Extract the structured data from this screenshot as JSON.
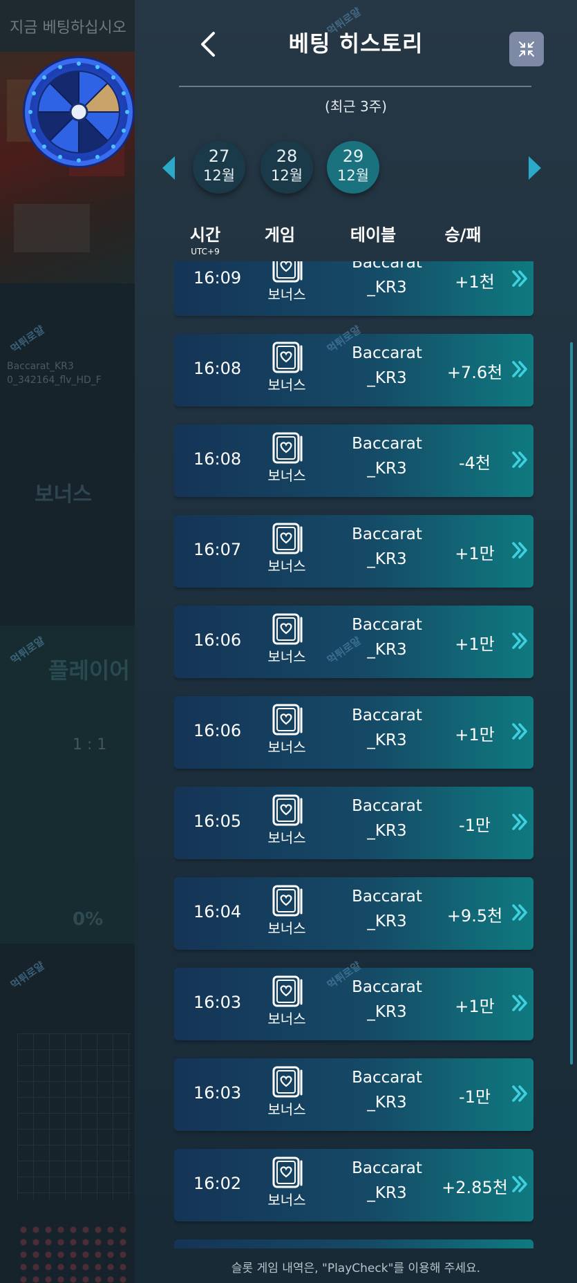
{
  "background": {
    "bet_hint": "지금 베팅하십시오",
    "table_id_line1": "Baccarat_KR3",
    "table_id_line2": "0_342164_flv_HD_F",
    "bonus_label": "보너스",
    "player_label": "플레이어",
    "ratio": "1 : 1",
    "percent": "0%"
  },
  "header": {
    "title": "베팅 히스토리",
    "subtitle": "(최근 3주)"
  },
  "dates": [
    {
      "day": "27",
      "month": "12월"
    },
    {
      "day": "28",
      "month": "12월"
    },
    {
      "day": "29",
      "month": "12월",
      "selected": true
    }
  ],
  "columns": {
    "time": "시간",
    "time_sub": "UTC+9",
    "game": "게임",
    "table": "테이블",
    "result": "승/패"
  },
  "rows": [
    {
      "time": "16:09",
      "game": "보너스",
      "table_line1": "Baccarat",
      "table_line2": "_KR3",
      "result": "+1천"
    },
    {
      "time": "16:08",
      "game": "보너스",
      "table_line1": "Baccarat",
      "table_line2": "_KR3",
      "result": "+7.6천"
    },
    {
      "time": "16:08",
      "game": "보너스",
      "table_line1": "Baccarat",
      "table_line2": "_KR3",
      "result": "-4천"
    },
    {
      "time": "16:07",
      "game": "보너스",
      "table_line1": "Baccarat",
      "table_line2": "_KR3",
      "result": "+1만"
    },
    {
      "time": "16:06",
      "game": "보너스",
      "table_line1": "Baccarat",
      "table_line2": "_KR3",
      "result": "+1만"
    },
    {
      "time": "16:06",
      "game": "보너스",
      "table_line1": "Baccarat",
      "table_line2": "_KR3",
      "result": "+1만"
    },
    {
      "time": "16:05",
      "game": "보너스",
      "table_line1": "Baccarat",
      "table_line2": "_KR3",
      "result": "-1만"
    },
    {
      "time": "16:04",
      "game": "보너스",
      "table_line1": "Baccarat",
      "table_line2": "_KR3",
      "result": "+9.5천"
    },
    {
      "time": "16:03",
      "game": "보너스",
      "table_line1": "Baccarat",
      "table_line2": "_KR3",
      "result": "+1만"
    },
    {
      "time": "16:03",
      "game": "보너스",
      "table_line1": "Baccarat",
      "table_line2": "_KR3",
      "result": "-1만"
    },
    {
      "time": "16:02",
      "game": "보너스",
      "table_line1": "Baccarat",
      "table_line2": "_KR3",
      "result": "+2.85천"
    }
  ],
  "footer": "슬롯 게임 내역은, \"PlayCheck\"를 이용해 주세요.",
  "watermark": "먹튀로얄",
  "colors": {
    "accent": "#19727e",
    "chevron": "#3fd0e0",
    "panel": "#1d2f3c"
  },
  "icons": {
    "back": "chevron-left-icon",
    "collapse": "collapse-icon",
    "close": "close-icon",
    "game": "heart-card-icon",
    "row_chevron": "double-chevron-right-icon"
  }
}
